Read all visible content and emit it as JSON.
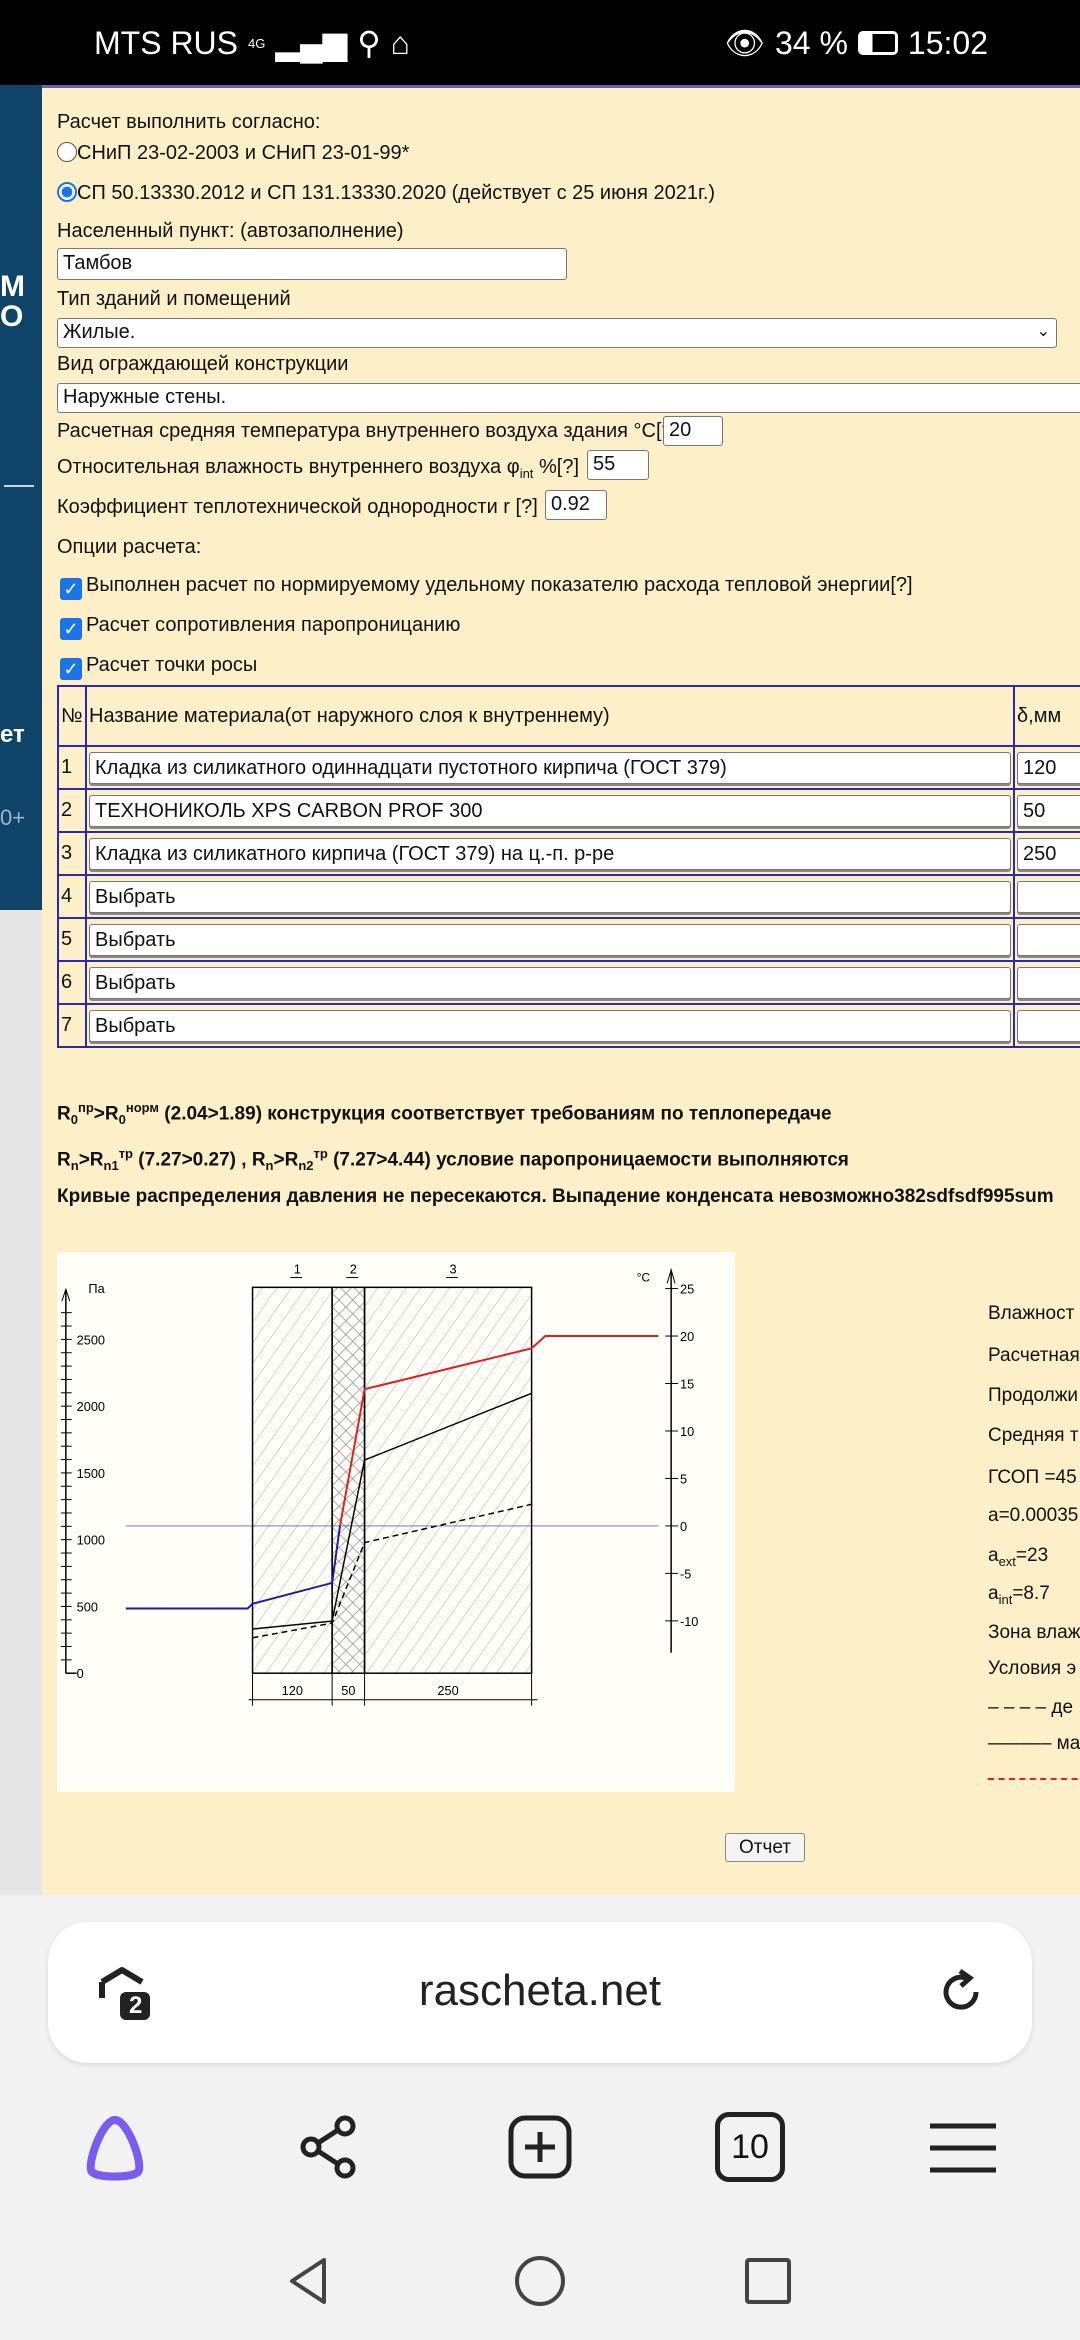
{
  "status": {
    "carrier": "MTS RUS",
    "network": "4G",
    "battery": "34 %",
    "time": "15:02"
  },
  "form": {
    "calc_label": "Расчет выполнить согласно:",
    "norm_options": [
      {
        "label": "СНиП 23-02-2003 и СНиП 23-01-99*",
        "selected": false
      },
      {
        "label": "СП 50.13330.2012 и СП 131.13330.2020 (действует с 25 июня 2021г.)",
        "selected": true
      }
    ],
    "city_label": "Населенный пункт: (автозаполнение)",
    "city_value": "Тамбов",
    "building_label": "Тип зданий и помещений",
    "building_value": "Жилые.",
    "construction_label": "Вид ограждающей конструкции",
    "construction_value": "Наружные стены.",
    "temp_label": "Расчетная средняя температура внутреннего воздуха здания °С[?]",
    "temp_value": "20",
    "humidity_label": "Относительная влажность внутреннего воздуха φ",
    "humidity_sub": "int",
    "humidity_suffix": " %[?]",
    "humidity_value": "55",
    "coef_label": "Коэффициент теплотехнической однородности r [?]",
    "coef_value": "0.92",
    "options_label": "Опции расчета:",
    "options": [
      {
        "label": "Выполнен расчет по нормируемому удельному показателю расхода тепловой энергии[?]",
        "checked": true
      },
      {
        "label": "Расчет сопротивления паропроницанию",
        "checked": true
      },
      {
        "label": "Расчет точки росы",
        "checked": true
      }
    ]
  },
  "table": {
    "headers": [
      "№",
      "Название материала(от наружного слоя к внутреннему)",
      "δ,мм"
    ],
    "rows": [
      [
        "1",
        "Кладка из силикатного одиннадцати пустотного кирпича (ГОСТ 379)",
        "120"
      ],
      [
        "2",
        "ТЕХНОНИКОЛЬ XPS CARBON PROF 300",
        "50"
      ],
      [
        "3",
        "Кладка из силикатного кирпича (ГОСТ 379) на ц.-п. р-ре",
        "250"
      ],
      [
        "4",
        "Выбрать",
        ""
      ],
      [
        "5",
        "Выбрать",
        ""
      ],
      [
        "6",
        "Выбрать",
        ""
      ],
      [
        "7",
        "Выбрать",
        ""
      ]
    ]
  },
  "results": {
    "r1": {
      "a": "R",
      "a_sub": "0",
      "a_sup": "пр",
      "gt": ">",
      "b": "R",
      "b_sub": "0",
      "b_sup": "норм",
      "rest": " (2.04>1.89) конструкция соответствует требованиям по теплопередаче"
    },
    "r2": {
      "p1": "R",
      "p1s": "n",
      "p2": ">R",
      "p2s": "n1",
      "p2u": "тр",
      "p3": " (7.27>0.27) , R",
      "p3s": "n",
      "p4": ">R",
      "p4s": "n2",
      "p4u": "тр",
      "p5": " (7.27>4.44) условие паропроницаемости выполняются"
    },
    "r3": "Кривые распределения давления не пересекаются. Выпадение конденсата невозможно382sdfsdf995sum"
  },
  "diagram": {
    "left_axis_unit": "Па",
    "left_ticks": [
      "0",
      "500",
      "1000",
      "1500",
      "2000",
      "2500"
    ],
    "left_range": [
      0,
      2500
    ],
    "right_axis_unit": "°С",
    "right_ticks": [
      "-10",
      "-5",
      "0",
      "5",
      "10",
      "15",
      "20",
      "25"
    ],
    "right_range": [
      -10,
      25
    ],
    "layer_labels": [
      "1",
      "2",
      "3"
    ],
    "layer_thickness": [
      "120",
      "50",
      "250"
    ],
    "temperature_c": {
      "exterior": -8.7,
      "outer_surface": -8.2,
      "layer1_2": -6.0,
      "layer2_3": 14.4,
      "inner_surface": 18.7,
      "interior": 20
    },
    "pressure_max_pa": [
      331,
      390,
      1596,
      2096
    ],
    "pressure_actual_pa": [
      265,
      375,
      978,
      1265
    ],
    "colors": {
      "temp_above_zero": "#e02020",
      "temp_below_zero": "#1a1aa8",
      "pressure": "#000000",
      "zero_line": "#2a2a9a"
    }
  },
  "side_info": [
    "Влажност",
    "Расчетная",
    "Продолжи",
    "Средняя т",
    "ГСОП =45",
    "a=0.00035",
    "a|ext|=23",
    "a|int|=8.7",
    "Зона влаж",
    "Условия э",
    "– – – – де",
    "–––––– ма"
  ],
  "report_button": "Отчет",
  "browser": {
    "url": "rascheta.net",
    "tabs_count": "10",
    "shield_count": "2"
  },
  "colors": {
    "page_bg": "#fdefc8",
    "table_border": "#2b2ba8",
    "accent": "#1a73e8",
    "alice": "#7b5cf0"
  }
}
